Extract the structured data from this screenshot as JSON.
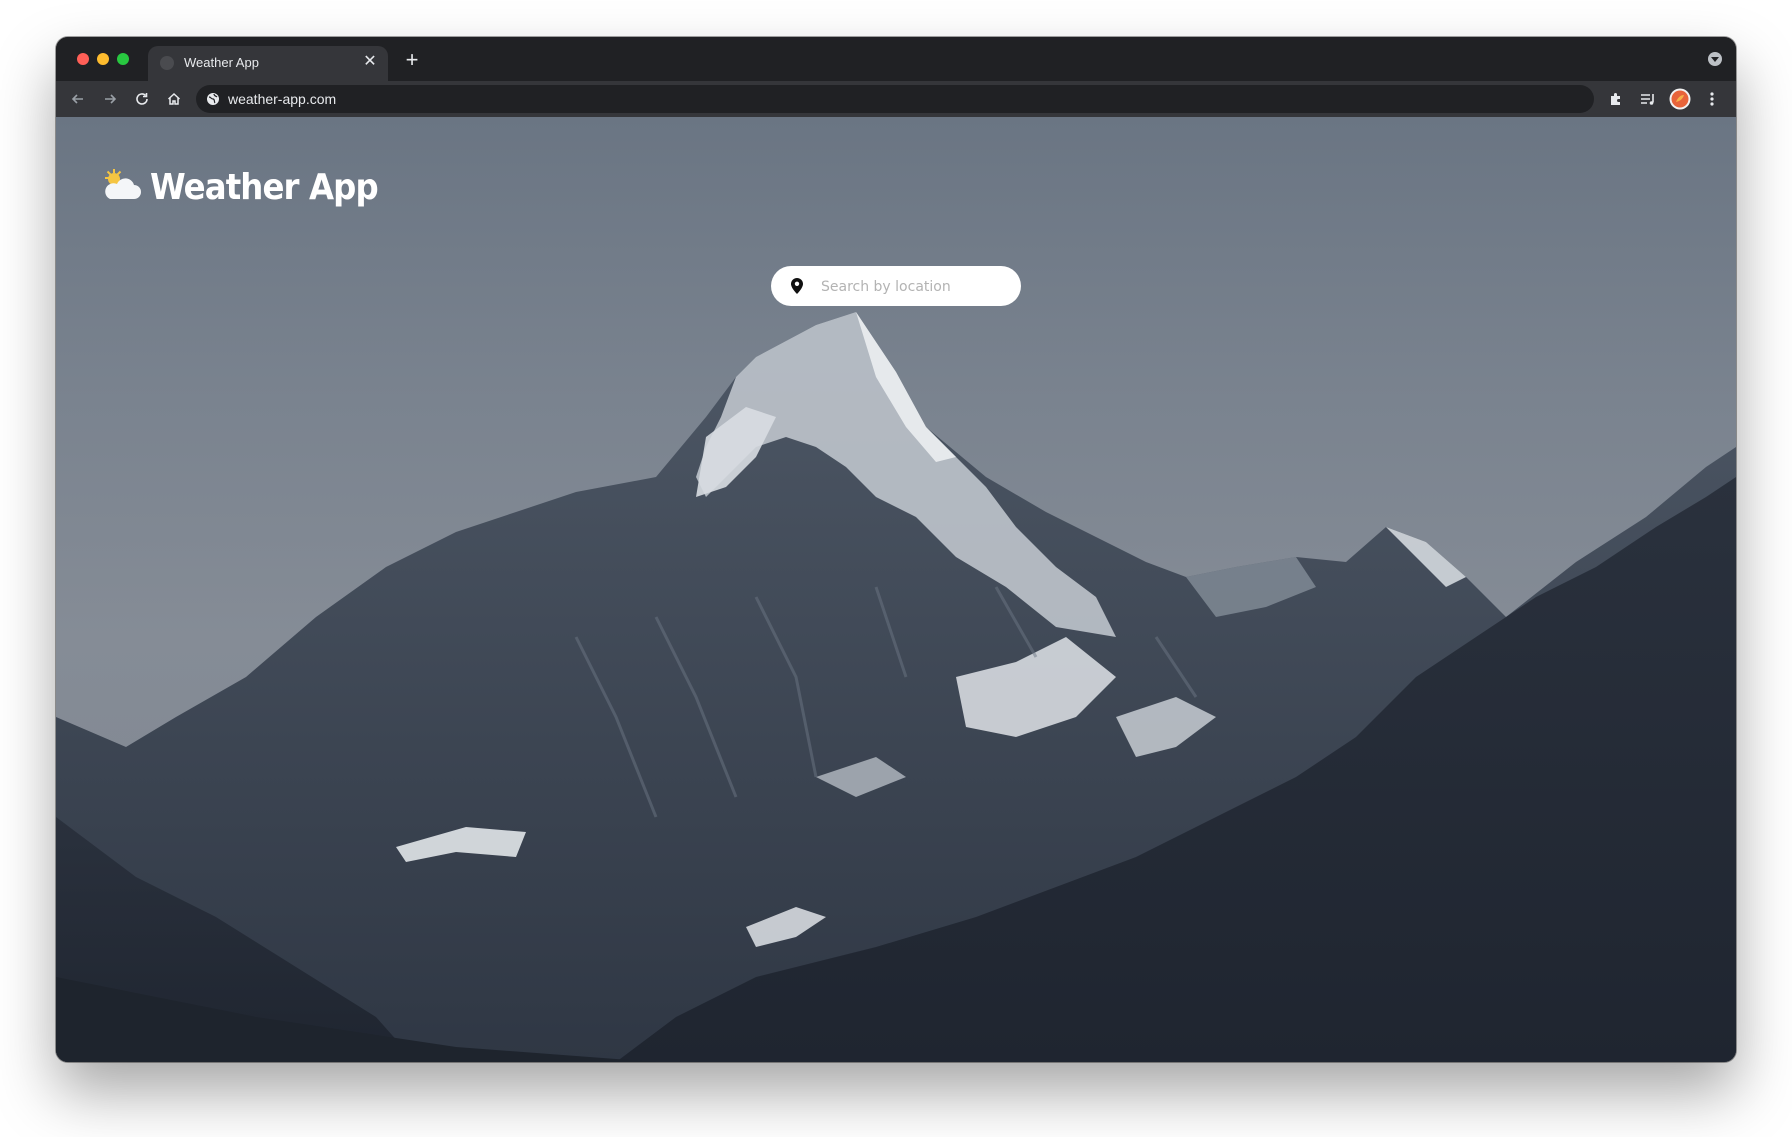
{
  "browser": {
    "tab": {
      "title": "Weather App",
      "close_glyph": "✕"
    },
    "new_tab_glyph": "+",
    "address_bar": {
      "url": "weather-app.com"
    },
    "toolbar_icons": [
      "back-arrow-icon",
      "forward-arrow-icon",
      "reload-icon",
      "home-icon",
      "site-info-icon",
      "extensions-icon",
      "reading-list-icon",
      "profile-avatar",
      "menu-kebab-icon"
    ]
  },
  "app": {
    "title": "Weather App",
    "logo_icon": "sun-behind-cloud-icon",
    "search": {
      "placeholder": "Search by location",
      "icon": "location-pin-icon"
    }
  },
  "colors": {
    "chrome_dark": "#202124",
    "chrome_toolbar": "#35363a",
    "sky": "#7a838f",
    "mountain_dark": "#2c3340",
    "snow": "#e6e9ec"
  }
}
